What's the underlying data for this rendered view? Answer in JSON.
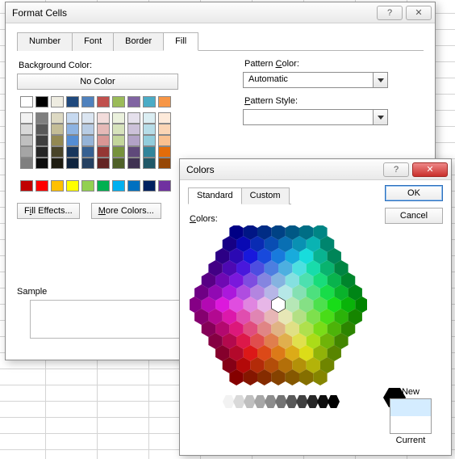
{
  "format_cells": {
    "title": "Format Cells",
    "tabs": [
      "Number",
      "Font",
      "Border",
      "Fill"
    ],
    "active_tab": "Fill",
    "bg_label": "Background Color:",
    "no_color": "No Color",
    "fill_effects": "Fill Effects...",
    "more_colors": "More Colors...",
    "pattern_color_label": "Pattern Color:",
    "pattern_color_value": "Automatic",
    "pattern_style_label": "Pattern Style:",
    "pattern_style_value": "",
    "sample_label": "Sample",
    "theme_colors": [
      "#ffffff",
      "#000000",
      "#eeece1",
      "#1f497d",
      "#4f81bd",
      "#c0504d",
      "#9bbb59",
      "#8064a2",
      "#4bacc6",
      "#f79646"
    ],
    "theme_tints": [
      [
        "#f2f2f2",
        "#7f7f7f",
        "#ddd9c3",
        "#c6d9f0",
        "#dbe5f1",
        "#f2dcdb",
        "#ebf1dd",
        "#e5e0ec",
        "#dbeef3",
        "#fdeada"
      ],
      [
        "#d8d8d8",
        "#595959",
        "#c4bd97",
        "#8db3e2",
        "#b8cce4",
        "#e5b9b7",
        "#d7e3bc",
        "#ccc1d9",
        "#b7dde8",
        "#fbd5b5"
      ],
      [
        "#bfbfbf",
        "#3f3f3f",
        "#938953",
        "#548dd4",
        "#95b3d7",
        "#d99694",
        "#c3d69b",
        "#b2a2c7",
        "#92cddc",
        "#fac08f"
      ],
      [
        "#a5a5a5",
        "#262626",
        "#494429",
        "#17365d",
        "#366092",
        "#953734",
        "#76923c",
        "#5f497a",
        "#31859b",
        "#e36c09"
      ],
      [
        "#7f7f7f",
        "#0c0c0c",
        "#1d1b10",
        "#0f243e",
        "#244061",
        "#632423",
        "#4f6128",
        "#3f3151",
        "#205867",
        "#974806"
      ]
    ],
    "standard_colors": [
      "#c00000",
      "#ff0000",
      "#ffc000",
      "#ffff00",
      "#92d050",
      "#00b050",
      "#00b0f0",
      "#0070c0",
      "#002060",
      "#7030a0"
    ]
  },
  "colors_dialog": {
    "title": "Colors",
    "tabs": [
      "Standard",
      "Custom"
    ],
    "active_tab": "Standard",
    "ok": "OK",
    "cancel": "Cancel",
    "colors_label": "Colors:",
    "new_label": "New",
    "current_label": "Current",
    "new_color": "#d4ecff",
    "current_color": "#ffffff",
    "grays": [
      "#ffffff",
      "#f2f2f2",
      "#d9d9d9",
      "#bfbfbf",
      "#a6a6a6",
      "#8c8c8c",
      "#737373",
      "#595959",
      "#404040",
      "#262626",
      "#0d0d0d",
      "#000000"
    ]
  }
}
